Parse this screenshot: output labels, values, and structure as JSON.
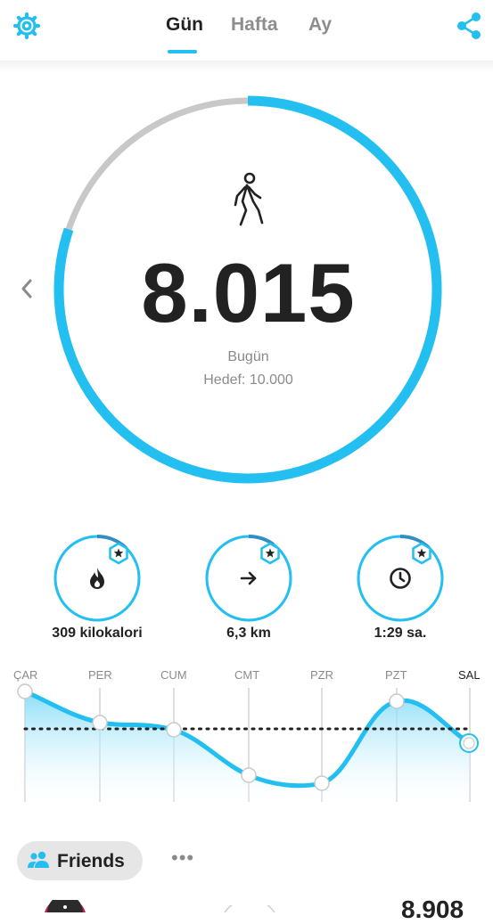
{
  "tabs": [
    {
      "label": "Gün",
      "active": true
    },
    {
      "label": "Hafta",
      "active": false
    },
    {
      "label": "Ay",
      "active": false
    }
  ],
  "icons": {
    "settings": "gear-icon",
    "share": "share-icon",
    "walker": "walking-person-icon",
    "prev": "chevron-left-icon"
  },
  "steps": {
    "value": "8.015",
    "day_label": "Bugün",
    "goal_label": "Hedef: 10.000",
    "progress": 0.8015
  },
  "metrics": [
    {
      "label": "309 kilokalori",
      "icon": "flame-icon",
      "badge": "star-badge-icon",
      "progress": 0.12
    },
    {
      "label": "6,3 km",
      "icon": "arrow-right-icon",
      "badge": "star-badge-icon",
      "progress": 0.1
    },
    {
      "label": "1:29 sa.",
      "icon": "clock-icon",
      "badge": "star-badge-icon",
      "progress": 0.12
    }
  ],
  "week_chart": {
    "days": [
      "ÇAR",
      "PER",
      "CUM",
      "CMT",
      "PZR",
      "PZT",
      "SAL"
    ],
    "current_day": "SAL"
  },
  "friends": {
    "label": "Friends",
    "more": "•••",
    "first_entry_value": "8.908"
  },
  "colors": {
    "accent": "#22bff0",
    "ring_track": "#c8c8c8",
    "text": "#222222",
    "muted": "#8a8a8a"
  }
}
